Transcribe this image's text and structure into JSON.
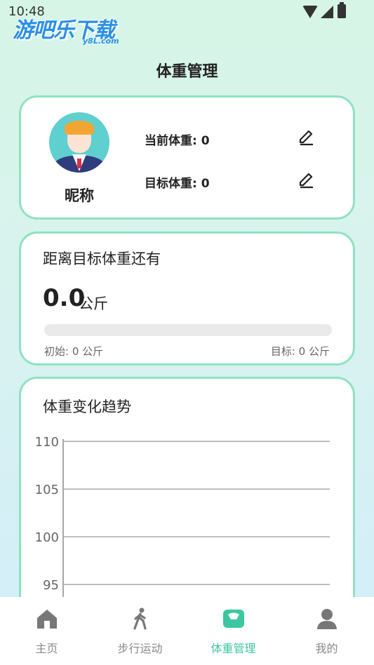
{
  "status_bar": {
    "time": "10:48"
  },
  "watermark": {
    "brand": "游吧乐下载",
    "site": "y8L.com"
  },
  "header": {
    "title": "体重管理"
  },
  "profile": {
    "nickname": "昵称",
    "current_weight": "当前体重: 0",
    "target_weight": "目标体重: 0"
  },
  "progress": {
    "title": "距离目标体重还有",
    "remaining_value": "0.0",
    "unit": "公斤",
    "progress_fraction": 0,
    "initial": "初始:  0  公斤",
    "target": "目标:  0  公斤"
  },
  "trend": {
    "title": "体重变化趋势"
  },
  "chart_data": {
    "type": "line",
    "title": "",
    "xlabel": "",
    "ylabel": "",
    "y_ticks": [
      110,
      105,
      100,
      95
    ],
    "ylim": [
      92,
      112
    ],
    "series": [],
    "grid": true
  },
  "tabbar": {
    "items": [
      {
        "label": "主页",
        "icon": "home-icon"
      },
      {
        "label": "步行运动",
        "icon": "walking-icon"
      },
      {
        "label": "体重管理",
        "icon": "scale-icon",
        "active": true
      },
      {
        "label": "我的",
        "icon": "user-icon"
      }
    ],
    "accent": "#3cc7a0"
  }
}
